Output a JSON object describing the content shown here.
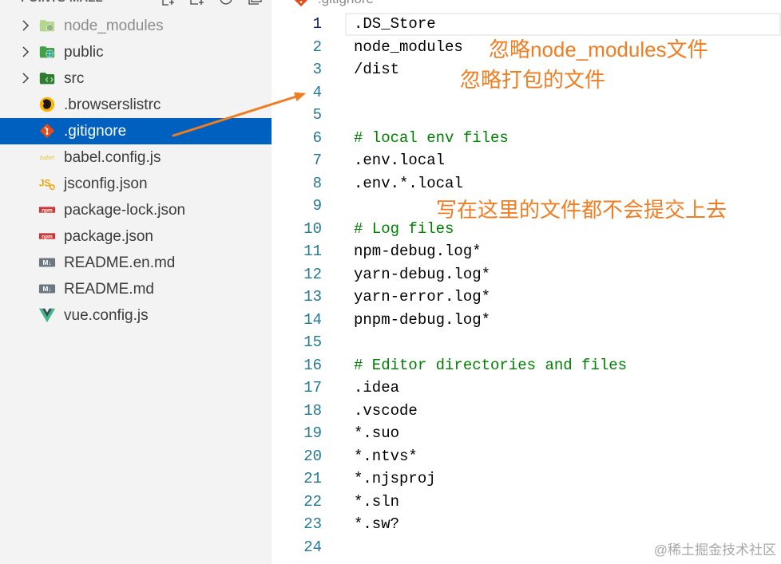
{
  "explorer": {
    "title": "POINTS-MALL",
    "header_icons": [
      "new-file-icon",
      "new-folder-icon",
      "refresh-icon",
      "collapse-all-icon"
    ],
    "items": [
      {
        "label": "node_modules",
        "type": "folder",
        "expanded": false,
        "icon": "node-modules-folder-icon",
        "git_ignored": true
      },
      {
        "label": "public",
        "type": "folder",
        "expanded": false,
        "icon": "public-folder-icon"
      },
      {
        "label": "src",
        "type": "folder",
        "expanded": false,
        "icon": "src-folder-icon"
      },
      {
        "label": ".browserslistrc",
        "type": "file",
        "icon": "browserslist-icon"
      },
      {
        "label": ".gitignore",
        "type": "file",
        "icon": "git-icon",
        "selected": true
      },
      {
        "label": "babel.config.js",
        "type": "file",
        "icon": "babel-icon",
        "icon_text": "babel"
      },
      {
        "label": "jsconfig.json",
        "type": "file",
        "icon": "jsconfig-icon",
        "icon_text": "JS"
      },
      {
        "label": "package-lock.json",
        "type": "file",
        "icon": "npm-icon",
        "icon_text": "npm"
      },
      {
        "label": "package.json",
        "type": "file",
        "icon": "npm-icon",
        "icon_text": "npm"
      },
      {
        "label": "README.en.md",
        "type": "file",
        "icon": "markdown-icon",
        "icon_text": "M↓"
      },
      {
        "label": "README.md",
        "type": "file",
        "icon": "markdown-icon",
        "icon_text": "M↓"
      },
      {
        "label": "vue.config.js",
        "type": "file",
        "icon": "vue-icon"
      }
    ]
  },
  "editor": {
    "tab": {
      "label": ".gitignore",
      "icon": "git-icon"
    },
    "active_line": 1,
    "lines": [
      {
        "number": "1",
        "text": ".DS_Store"
      },
      {
        "number": "2",
        "text": "node_modules"
      },
      {
        "number": "3",
        "text": "/dist"
      },
      {
        "number": "4",
        "text": ""
      },
      {
        "number": "5",
        "text": ""
      },
      {
        "number": "6",
        "text": "# local env files",
        "kind": "comment"
      },
      {
        "number": "7",
        "text": ".env.local"
      },
      {
        "number": "8",
        "text": ".env.*.local"
      },
      {
        "number": "9",
        "text": ""
      },
      {
        "number": "10",
        "text": "# Log files",
        "kind": "comment"
      },
      {
        "number": "11",
        "text": "npm-debug.log*"
      },
      {
        "number": "12",
        "text": "yarn-debug.log*"
      },
      {
        "number": "13",
        "text": "yarn-error.log*"
      },
      {
        "number": "14",
        "text": "pnpm-debug.log*"
      },
      {
        "number": "15",
        "text": ""
      },
      {
        "number": "16",
        "text": "# Editor directories and files",
        "kind": "comment"
      },
      {
        "number": "17",
        "text": ".idea"
      },
      {
        "number": "18",
        "text": ".vscode"
      },
      {
        "number": "19",
        "text": "*.suo"
      },
      {
        "number": "20",
        "text": "*.ntvs*"
      },
      {
        "number": "21",
        "text": "*.njsproj"
      },
      {
        "number": "22",
        "text": "*.sln"
      },
      {
        "number": "23",
        "text": "*.sw?"
      },
      {
        "number": "24",
        "text": ""
      }
    ]
  },
  "annotations": [
    {
      "text": "忽略node_modules文件"
    },
    {
      "text": "忽略打包的文件"
    },
    {
      "text": "写在这里的文件都不会提交上去"
    }
  ],
  "watermark": "@稀土掘金技术社区",
  "colors": {
    "sidebar_background": "#f3f3f3",
    "selection": "#0060c0",
    "line_number": "#237893",
    "active_line_number": "#0b216f",
    "comment": "#008000",
    "annotation": "#ef7d22",
    "watermark": "#a8a8a8"
  }
}
